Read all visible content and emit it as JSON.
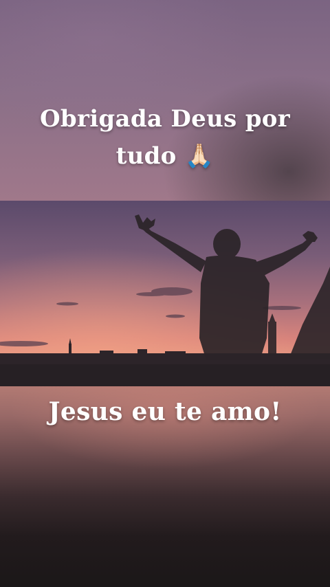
{
  "captions": {
    "top_text": "Obrigada Deus por tudo",
    "top_emoji": "🙏🏻",
    "bottom_text": "Jesus eu te amo!"
  },
  "scene": {
    "description_icon": "praying-hands-icon",
    "colors": {
      "sky_top": "#7b6482",
      "sky_glow": "#e58e7d",
      "silhouette": "#2a2428",
      "text": "#ffffff"
    }
  }
}
